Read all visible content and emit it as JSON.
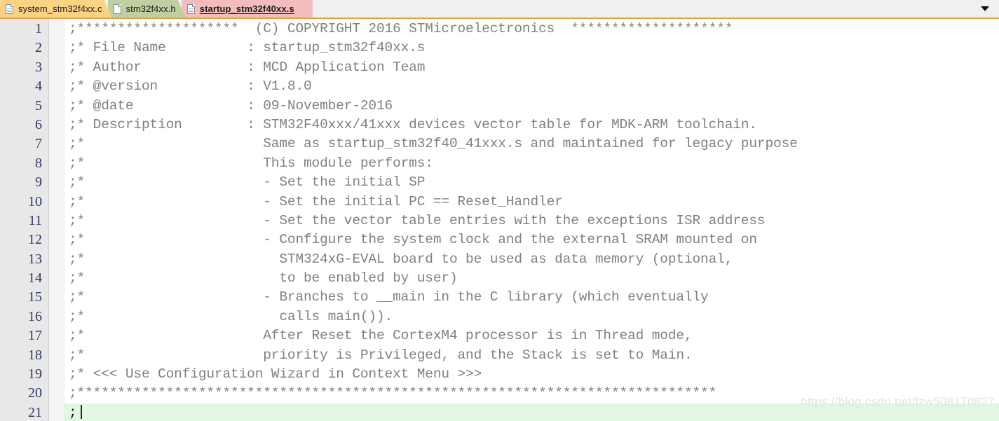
{
  "tabbar": {
    "tabs": [
      {
        "label": "system_stm32f4xx.c",
        "color": "#fcd383",
        "active": false,
        "icon": "document-icon"
      },
      {
        "label": "stm32f4xx.h",
        "color": "#bdd0a0",
        "active": false,
        "icon": "document-icon"
      },
      {
        "label": "startup_stm32f40xx.s",
        "color": "#f3bdbd",
        "active": true,
        "icon": "document-icon"
      }
    ],
    "dropdown_icon": "chevron-down-icon",
    "separator_color": "#e8a33d"
  },
  "editor": {
    "gutter_bg": "#e8e8e8",
    "line_number_color": "#2e3b63",
    "comment_color": "#808080",
    "active_line_bg": "#e2f7e2",
    "lines": [
      {
        "n": "1",
        "text": ";********************  (C) COPYRIGHT 2016 STMicroelectronics  ********************"
      },
      {
        "n": "2",
        "text": ";* File Name          : startup_stm32f40xx.s"
      },
      {
        "n": "3",
        "text": ";* Author             : MCD Application Team"
      },
      {
        "n": "4",
        "text": ";* @version           : V1.8.0"
      },
      {
        "n": "5",
        "text": ";* @date              : 09-November-2016"
      },
      {
        "n": "6",
        "text": ";* Description        : STM32F40xxx/41xxx devices vector table for MDK-ARM toolchain."
      },
      {
        "n": "7",
        "text": ";*                      Same as startup_stm32f40_41xxx.s and maintained for legacy purpose"
      },
      {
        "n": "8",
        "text": ";*                      This module performs:"
      },
      {
        "n": "9",
        "text": ";*                      - Set the initial SP"
      },
      {
        "n": "10",
        "text": ";*                      - Set the initial PC == Reset_Handler"
      },
      {
        "n": "11",
        "text": ";*                      - Set the vector table entries with the exceptions ISR address"
      },
      {
        "n": "12",
        "text": ";*                      - Configure the system clock and the external SRAM mounted on"
      },
      {
        "n": "13",
        "text": ";*                        STM324xG-EVAL board to be used as data memory (optional,"
      },
      {
        "n": "14",
        "text": ";*                        to be enabled by user)"
      },
      {
        "n": "15",
        "text": ";*                      - Branches to __main in the C library (which eventually"
      },
      {
        "n": "16",
        "text": ";*                        calls main())."
      },
      {
        "n": "17",
        "text": ";*                      After Reset the CortexM4 processor is in Thread mode,"
      },
      {
        "n": "18",
        "text": ";*                      priority is Privileged, and the Stack is set to Main."
      },
      {
        "n": "19",
        "text": ";* <<< Use Configuration Wizard in Context Menu >>>"
      },
      {
        "n": "20",
        "text": ";*******************************************************************************"
      },
      {
        "n": "21",
        "text": ";",
        "active": true,
        "caret": true
      }
    ]
  },
  "watermark": {
    "text": "https://blog.csdn.net/lzw508170827"
  }
}
